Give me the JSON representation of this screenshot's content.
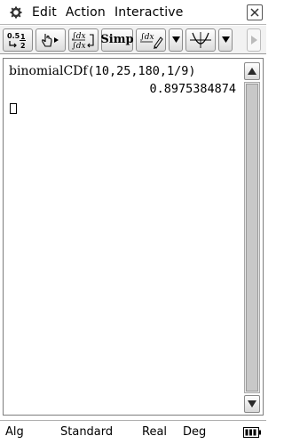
{
  "menubar": {
    "items": [
      "Edit",
      "Action",
      "Interactive"
    ]
  },
  "toolbar": {
    "simp_label": "Simp"
  },
  "work": {
    "input_fn": "binomialCDf",
    "input_args": "(10,25,180,1/9)",
    "output": "0.8975384874"
  },
  "status": {
    "mode": "Alg",
    "format": "Standard",
    "number_domain": "Real",
    "angle": "Deg"
  },
  "colors": {
    "scroll_arrow": "#2a2a2a",
    "toolbar_bg": "#f2f2f2"
  }
}
